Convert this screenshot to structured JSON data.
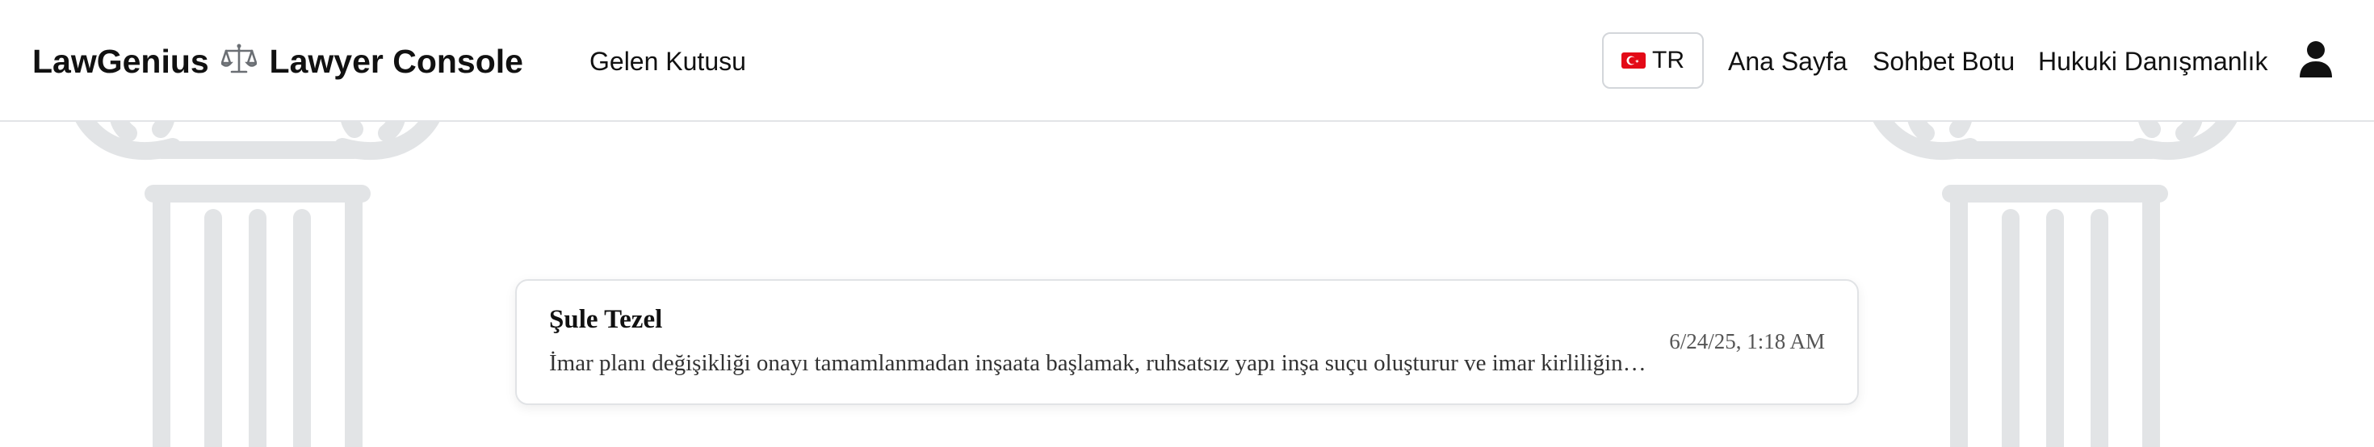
{
  "header": {
    "brand_name": "LawGenius",
    "brand_suffix": "Lawyer Console",
    "inbox_label": "Gelen Kutusu",
    "language_label": "TR",
    "nav": {
      "home": "Ana Sayfa",
      "chatbot": "Sohbet Botu",
      "legal_advice": "Hukuki Danışmanlık"
    }
  },
  "messages": [
    {
      "sender": "Şule Tezel",
      "preview": "İmar planı değişikliği onayı tamamlanmadan inşaata başlamak, ruhsatsız yapı inşa suçu oluşturur ve imar kirliliğine neden olur.",
      "timestamp": "6/24/25, 1:18 AM"
    }
  ],
  "colors": {
    "pillar": "#e2e4e6",
    "flag_red": "#e30a17",
    "text_primary": "#111111",
    "border": "#e1e3e6"
  },
  "icons": {
    "brand": "scales-icon",
    "language": "turkey-flag-icon",
    "user": "user-icon",
    "decoration": "ionic-column-icon"
  }
}
